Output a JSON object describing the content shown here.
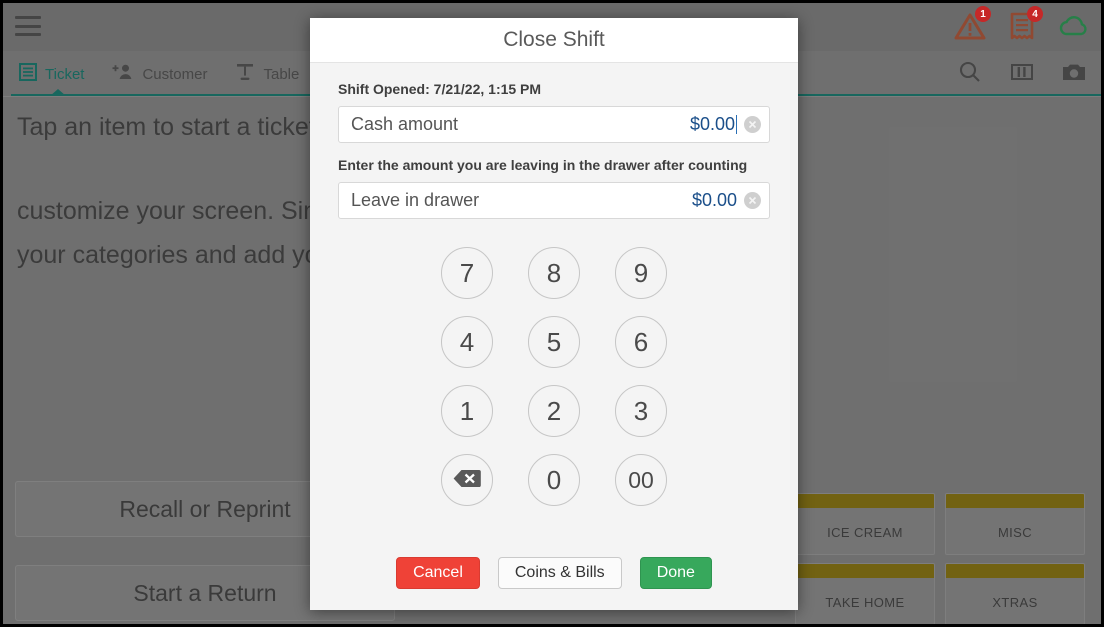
{
  "app": {
    "topbar": {
      "menu_icon": "hamburger-icon",
      "icons": [
        {
          "name": "warning-icon",
          "badge": "1",
          "color": "#b5502e"
        },
        {
          "name": "receipt-icon",
          "badge": "4",
          "color": "#b5502e"
        },
        {
          "name": "cloud-icon",
          "badge": "",
          "color": "#1f9d4e"
        }
      ]
    },
    "tabs": [
      {
        "label": "Ticket",
        "icon": "list-icon",
        "active": true
      },
      {
        "label": "Customer",
        "icon": "add-person-icon",
        "active": false
      },
      {
        "label": "Table",
        "icon": "table-icon",
        "active": false
      }
    ],
    "tab_icons": [
      {
        "name": "search-icon"
      },
      {
        "name": "columns-icon"
      },
      {
        "name": "camera-icon"
      }
    ],
    "content": {
      "hint_line1": "Tap an item to start a ticket, or add items to Favorites. It is easy to",
      "hint_line2": "customize your screen. Simply long press each button above, view",
      "hint_line3": "your categories and add your favorite items to Favorites."
    },
    "left_buttons": [
      {
        "label": "Recall or Reprint"
      },
      {
        "label": "Start a Return"
      }
    ],
    "categories": [
      {
        "label": "ICE CREAM"
      },
      {
        "label": "MISC"
      },
      {
        "label": "TAKE HOME"
      },
      {
        "label": "XTRAS"
      }
    ]
  },
  "modal": {
    "title": "Close Shift",
    "shift_opened": "Shift Opened: 7/21/22, 1:15 PM",
    "cash_field": {
      "label": "Cash amount",
      "value": "$0.00",
      "clear_icon": "clear-circle-icon"
    },
    "drawer_note": "Enter the amount you are leaving in the drawer after counting",
    "drawer_field": {
      "label": "Leave in drawer",
      "value": "$0.00",
      "clear_icon": "clear-circle-icon"
    },
    "keypad": [
      {
        "label": "7",
        "name": "key-7"
      },
      {
        "label": "8",
        "name": "key-8"
      },
      {
        "label": "9",
        "name": "key-9"
      },
      {
        "label": "4",
        "name": "key-4"
      },
      {
        "label": "5",
        "name": "key-5"
      },
      {
        "label": "6",
        "name": "key-6"
      },
      {
        "label": "1",
        "name": "key-1"
      },
      {
        "label": "2",
        "name": "key-2"
      },
      {
        "label": "3",
        "name": "key-3"
      },
      {
        "label": "",
        "name": "key-backspace"
      },
      {
        "label": "0",
        "name": "key-0"
      },
      {
        "label": "00",
        "name": "key-double-zero"
      }
    ],
    "actions": {
      "cancel": "Cancel",
      "coins_bills": "Coins & Bills",
      "done": "Done"
    }
  },
  "colors": {
    "accent_teal": "#0a7a6e",
    "value_blue": "#1b4f8a",
    "cancel_red": "#ef4237",
    "done_green": "#37a85c",
    "category_gold": "#8a7300",
    "badge_red": "#c62828"
  }
}
